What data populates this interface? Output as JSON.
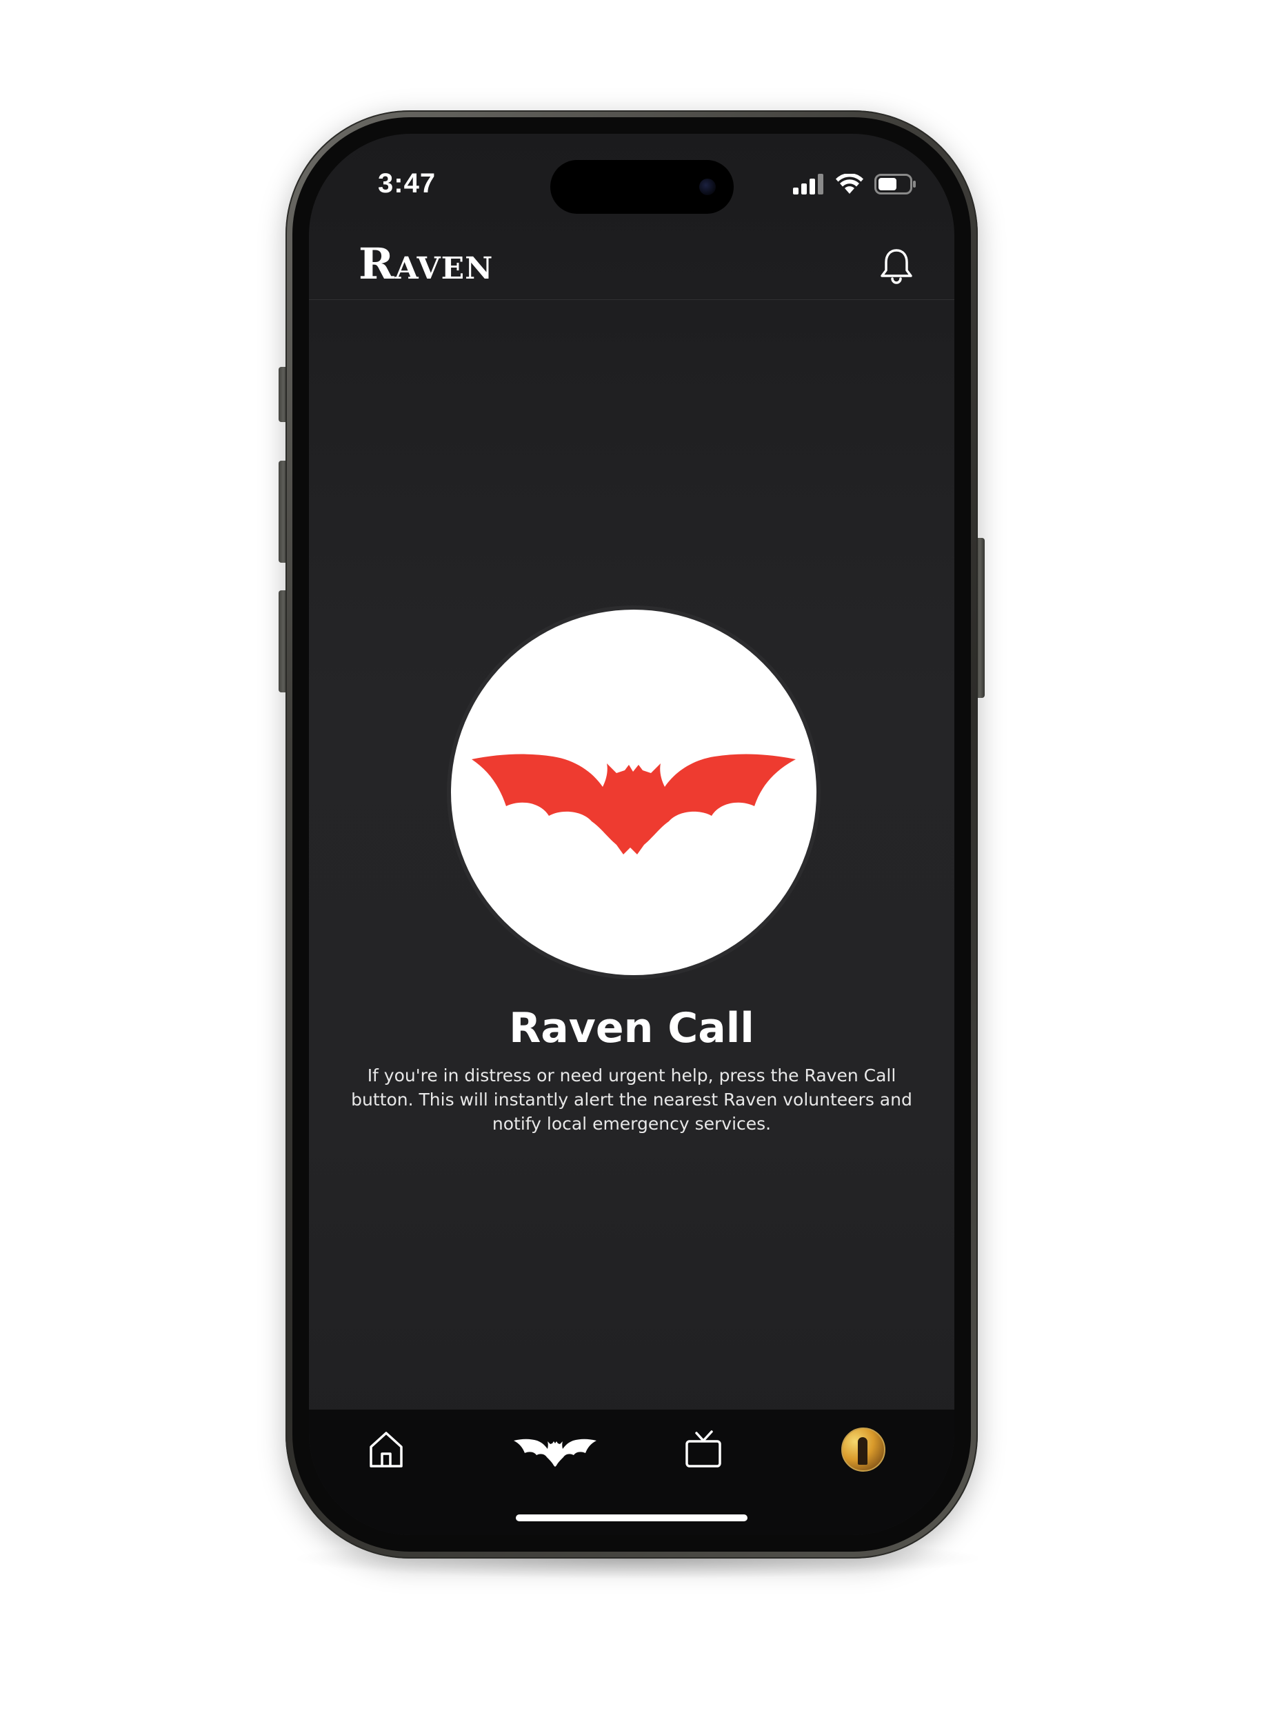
{
  "status_bar": {
    "time": "3:47"
  },
  "header": {
    "logo_initial": "R",
    "logo_rest": "AVEN"
  },
  "main": {
    "title": "Raven Call",
    "description": "If you're in distress or need urgent help, press the Raven Call button. This will instantly alert the nearest Raven volunteers and notify local emergency services."
  },
  "icons": {
    "call_button": "bat-icon",
    "notifications": "bell-icon",
    "tabs": [
      "home-icon",
      "bat-icon",
      "tv-icon",
      "avatar"
    ]
  },
  "colors": {
    "background": "#232325",
    "accent": "#ee3b30",
    "tab_bar": "#0b0b0c",
    "text": "#ffffff"
  }
}
